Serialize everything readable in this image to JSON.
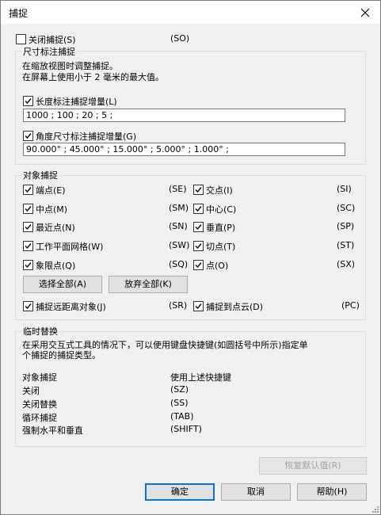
{
  "window": {
    "title": "捕捉"
  },
  "top": {
    "close_snap_label": "关闭捕捉(S)",
    "close_snap_shortcut": "(SO)"
  },
  "dim": {
    "group_title": "尺寸标注捕捉",
    "desc_line1": "在缩放视图时调整捕捉。",
    "desc_line2": "在屏幕上使用小于 2 毫米的最大值。",
    "length_label": "长度标注捕捉增量(L)",
    "length_value": "1000 ; 100 ; 20 ; 5 ;",
    "angle_label": "角度尺寸标注捕捉增量(G)",
    "angle_value": "90.000° ; 45.000° ; 15.000° ; 5.000° ; 1.000° ;"
  },
  "osnap": {
    "group_title": "对象捕捉",
    "left": [
      {
        "label": "端点(E)",
        "shortcut": "(SE)"
      },
      {
        "label": "中点(M)",
        "shortcut": "(SM)"
      },
      {
        "label": "最近点(N)",
        "shortcut": "(SN)"
      },
      {
        "label": "工作平面网格(W)",
        "shortcut": "(SW)"
      },
      {
        "label": "象限点(Q)",
        "shortcut": "(SQ)"
      }
    ],
    "right": [
      {
        "label": "交点(I)",
        "shortcut": "(SI)"
      },
      {
        "label": "中心(C)",
        "shortcut": "(SC)"
      },
      {
        "label": "垂直(P)",
        "shortcut": "(SP)"
      },
      {
        "label": "切点(T)",
        "shortcut": "(ST)"
      },
      {
        "label": "点(O)",
        "shortcut": "(SX)"
      }
    ],
    "select_all": "选择全部(A)",
    "clear_all": "放弃全部(K)",
    "remote_label": "捕捉远距离对象(J)",
    "remote_shortcut": "(SR)",
    "pointcloud_label": "捕捉到点云(D)",
    "pointcloud_shortcut": "(PC)"
  },
  "override": {
    "group_title": "临时替换",
    "desc_line1": "在采用交互式工具的情况下，可以使用键盘快捷键(如圆括号中所示)指定单",
    "desc_line2": "个捕捉的捕捉类型。",
    "rows": [
      {
        "name": "对象捕捉",
        "key": "使用上述快捷键"
      },
      {
        "name": "关闭",
        "key": "(SZ)"
      },
      {
        "name": "关闭替换",
        "key": "(SS)"
      },
      {
        "name": "循环捕捉",
        "key": "(TAB)"
      },
      {
        "name": "强制水平和垂直",
        "key": "(SHIFT)"
      }
    ]
  },
  "buttons": {
    "restore": "恢复默认值(R)",
    "ok": "确定",
    "cancel": "取消",
    "help": "帮助(H)"
  }
}
